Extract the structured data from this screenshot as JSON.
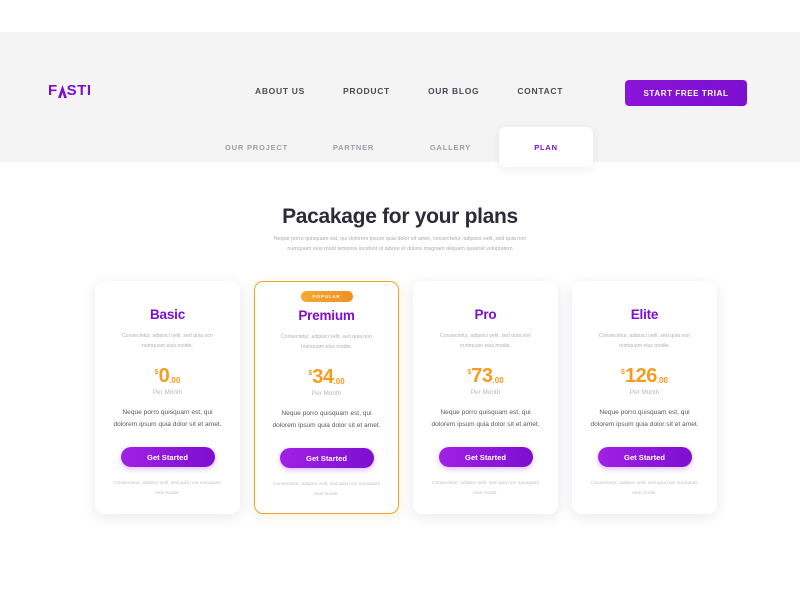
{
  "header": {
    "logo_text_pre": "F",
    "logo_icon": "a-mark-icon",
    "logo_text_post": "STI",
    "nav": [
      {
        "label": "ABOUT US"
      },
      {
        "label": "PRODUCT"
      },
      {
        "label": "OUR BLOG"
      },
      {
        "label": "CONTACT"
      }
    ],
    "cta_label": "START FREE TRIAL",
    "accent_purple": "#7d0fd0",
    "band_color": "#f4f4f5"
  },
  "tabs": [
    {
      "label": "OUR PROJECT",
      "active": false
    },
    {
      "label": "PARTNER",
      "active": false
    },
    {
      "label": "GALLERY",
      "active": false
    },
    {
      "label": "PLAN",
      "active": true
    }
  ],
  "section": {
    "title": "Pacakage for your plans",
    "subtitle_line1": "Neque porro quisquam est, qui dolorem ipsum quia dolor sit amet, consectetur, adipisci velit, sed quia non",
    "subtitle_line2": "numquam eius modi tempora incidunt ut labore et dolore magnam aliquam quaerat voluptatem"
  },
  "plans": [
    {
      "name": "Basic",
      "badge": "",
      "desc": "Consectetur, adipisci velit, sed quia non numquam eius modie.",
      "currency": "$",
      "amount": "0",
      "cents": ".00",
      "period": "Per Month",
      "body": "Neque porro quisquam est, qui dolorem ipsum quia dolor sit et amet.",
      "button": "Get Started",
      "footer": "Consectetur, adipisci velit, sed quia non numquam eius modie.",
      "featured": false
    },
    {
      "name": "Premium",
      "badge": "POPULAR",
      "desc": "Consectetur, adipisci velit, sed quia non numquam eius modie.",
      "currency": "$",
      "amount": "34",
      "cents": ".00",
      "period": "Per Month",
      "body": "Neque porro quisquam est, qui dolorem ipsum quia dolor sit et amet.",
      "button": "Get Started",
      "footer": "Consectetur, adipisci velit, sed quia non numquam eius modie.",
      "featured": true
    },
    {
      "name": "Pro",
      "badge": "",
      "desc": "Consectetur, adipisci velit, sed quia non numquam eius modie.",
      "currency": "$",
      "amount": "73",
      "cents": ".00",
      "period": "Per Month",
      "body": "Neque porro quisquam est, qui dolorem ipsum quia dolor sit et amet.",
      "button": "Get Started",
      "footer": "Consectetur, adipisci velit, sed quia non numquam eius modie.",
      "featured": false
    },
    {
      "name": "Elite",
      "badge": "",
      "desc": "Consectetur, adipisci velit, sed quia non numquam eius modie.",
      "currency": "$",
      "amount": "126",
      "cents": ".00",
      "period": "Per Month",
      "body": "Neque porro quisquam est, qui dolorem ipsum quia dolor sit et amet.",
      "button": "Get Started",
      "footer": "Consectetur, adipisci velit, sed quia non numquam eius modie.",
      "featured": false
    }
  ],
  "colors": {
    "purple": "#7d0fd0",
    "orange": "#f59c1f",
    "badge_orange": "#f0a12e",
    "heading": "#2b2b3a",
    "muted": "#b0b0bb"
  }
}
